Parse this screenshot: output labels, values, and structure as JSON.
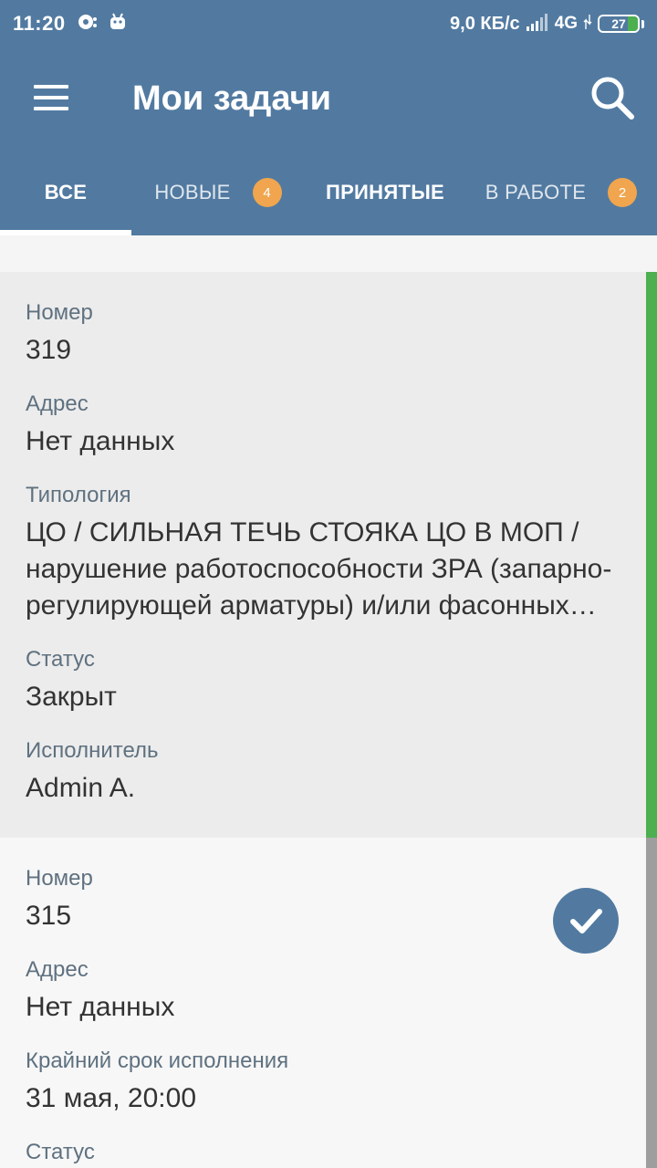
{
  "status_bar": {
    "time": "11:20",
    "net_speed": "9,0 КБ/с",
    "network": "4G",
    "battery": "27",
    "battery_level": 0.27
  },
  "app_bar": {
    "title": "Мои задачи"
  },
  "tabs": [
    {
      "label": "ВСЕ",
      "badge": null,
      "active": true
    },
    {
      "label": "НОВЫЕ",
      "badge": "4",
      "active": false
    },
    {
      "label": "ПРИНЯТЫЕ",
      "badge": null,
      "active": false
    },
    {
      "label": "В РАБОТЕ",
      "badge": "2",
      "active": false
    }
  ],
  "tasks": [
    {
      "fields": [
        {
          "label": "Номер",
          "value": "319"
        },
        {
          "label": "Адрес",
          "value": "Нет данных"
        },
        {
          "label": "Типология",
          "value": "ЦО / СИЛЬНАЯ ТЕЧЬ СТОЯКА ЦО В МОП / нарушение работоспособности ЗРА (запарно-регулирующей арматуры) и/или фасонных частей"
        },
        {
          "label": "Статус",
          "value": "Закрыт"
        },
        {
          "label": "Исполнитель",
          "value": "Admin A."
        }
      ],
      "stripe_color": "#4caf50"
    },
    {
      "fields": [
        {
          "label": "Номер",
          "value": "315"
        },
        {
          "label": "Адрес",
          "value": "Нет данных"
        },
        {
          "label": "Крайний срок исполнения",
          "value": "31 мая, 20:00"
        },
        {
          "label": "Статус",
          "value": ""
        }
      ],
      "stripe_color": "#9e9e9e",
      "checked": true
    }
  ],
  "colors": {
    "primary": "#527aa1",
    "badge": "#f0a54e",
    "closed": "#4caf50"
  }
}
